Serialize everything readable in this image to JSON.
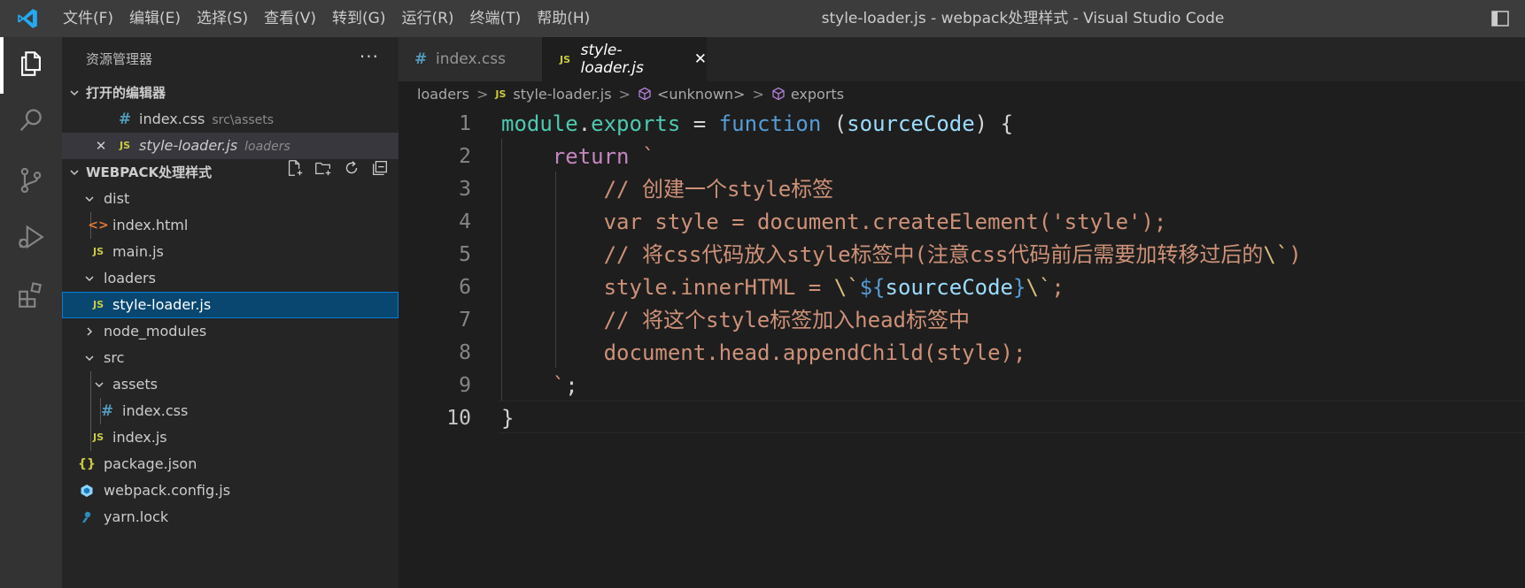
{
  "window": {
    "title": "style-loader.js - webpack处理样式 - Visual Studio Code",
    "menu": [
      "文件(F)",
      "编辑(E)",
      "选择(S)",
      "查看(V)",
      "转到(G)",
      "运行(R)",
      "终端(T)",
      "帮助(H)"
    ]
  },
  "activity_bar": {
    "items": [
      {
        "icon": "files-icon",
        "active": true
      },
      {
        "icon": "search-icon",
        "active": false
      },
      {
        "icon": "source-control-icon",
        "active": false
      },
      {
        "icon": "run-debug-icon",
        "active": false
      },
      {
        "icon": "extensions-icon",
        "active": false
      }
    ]
  },
  "sidebar": {
    "title": "资源管理器",
    "more": "···",
    "open_editors": {
      "label": "打开的编辑器",
      "items": [
        {
          "name": "index.css",
          "path": "src\\assets",
          "icon": "#"
        },
        {
          "name": "style-loader.js",
          "path": "loaders",
          "icon": "JS",
          "close": "✕"
        }
      ]
    },
    "project": {
      "label": "WEBPACK处理样式",
      "tree": [
        {
          "label": "dist",
          "type": "folder",
          "open": true
        },
        {
          "label": "index.html",
          "type": "html",
          "icon": "<>"
        },
        {
          "label": "main.js",
          "type": "js",
          "icon": "JS"
        },
        {
          "label": "loaders",
          "type": "folder",
          "open": true
        },
        {
          "label": "style-loader.js",
          "type": "js",
          "icon": "JS",
          "selected": true
        },
        {
          "label": "node_modules",
          "type": "folder",
          "open": false
        },
        {
          "label": "src",
          "type": "folder",
          "open": true
        },
        {
          "label": "assets",
          "type": "folder",
          "open": true
        },
        {
          "label": "index.css",
          "type": "css",
          "icon": "#"
        },
        {
          "label": "index.js",
          "type": "js",
          "icon": "JS"
        },
        {
          "label": "package.json",
          "type": "json",
          "icon": "{}"
        },
        {
          "label": "webpack.config.js",
          "type": "webpack"
        },
        {
          "label": "yarn.lock",
          "type": "yarn"
        }
      ]
    }
  },
  "tabs": [
    {
      "label": "index.css",
      "icon": "#",
      "active": false
    },
    {
      "label": "style-loader.js",
      "icon": "JS",
      "active": true,
      "close": "✕"
    }
  ],
  "breadcrumb": {
    "folder": "loaders",
    "file": "style-loader.js",
    "file_icon": "JS",
    "sep": ">",
    "symbols": [
      "<unknown>",
      "exports"
    ]
  },
  "editor": {
    "line_numbers": [
      "1",
      "2",
      "3",
      "4",
      "5",
      "6",
      "7",
      "8",
      "9",
      "10"
    ],
    "current_line": "10",
    "lines": [
      [
        [
          "t-teal",
          "module"
        ],
        [
          "t-def",
          "."
        ],
        [
          "t-teal",
          "exports"
        ],
        [
          "t-def",
          " = "
        ],
        [
          "t-kw",
          "function"
        ],
        [
          "t-def",
          " ("
        ],
        [
          "t-var",
          "sourceCode"
        ],
        [
          "t-def",
          ") {"
        ]
      ],
      [
        [
          "t-def",
          "    "
        ],
        [
          "t-ctl",
          "return"
        ],
        [
          "t-def",
          " "
        ],
        [
          "t-str",
          "`"
        ]
      ],
      [
        [
          "t-str",
          "        // 创建一个style标签"
        ]
      ],
      [
        [
          "t-str",
          "        var style = document.createElement('style');"
        ]
      ],
      [
        [
          "t-str",
          "        // 将css代码放入style标签中(注意css代码前后需要加转移过后的"
        ],
        [
          "t-esc",
          "\\`"
        ],
        [
          "t-str",
          ")"
        ]
      ],
      [
        [
          "t-str",
          "        style.innerHTML = "
        ],
        [
          "t-esc",
          "\\`"
        ],
        [
          "t-tpl",
          "${"
        ],
        [
          "t-var",
          "sourceCode"
        ],
        [
          "t-tpl",
          "}"
        ],
        [
          "t-esc",
          "\\`"
        ],
        [
          "t-str",
          ";"
        ]
      ],
      [
        [
          "t-str",
          "        // 将这个style标签加入head标签中"
        ]
      ],
      [
        [
          "t-str",
          "        document.head.appendChild(style);"
        ]
      ],
      [
        [
          "t-str",
          "    `"
        ],
        [
          "t-def",
          ";"
        ]
      ],
      [
        [
          "t-def",
          "}"
        ]
      ]
    ]
  }
}
